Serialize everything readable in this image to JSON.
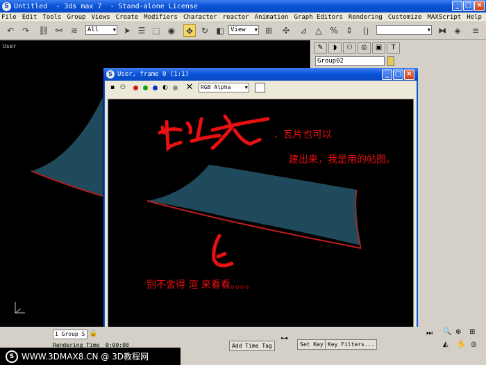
{
  "window": {
    "title": "Untitled  - 3ds max 7  - Stand-alone License",
    "controls": [
      "_",
      "□",
      "×"
    ]
  },
  "menu": [
    "File",
    "Edit",
    "Tools",
    "Group",
    "Views",
    "Create",
    "Modifiers",
    "Character",
    "reactor",
    "Animation",
    "Graph Editors",
    "Rendering",
    "Customize",
    "MAXScript",
    "Help"
  ],
  "toolbar": {
    "selection_filter": "All",
    "ref_coord": "View",
    "named_selection": ""
  },
  "viewport": {
    "label": "User"
  },
  "command_panel": {
    "object_name": "Group02"
  },
  "frame_window": {
    "title": "User, frame 0 (1:1)",
    "channel": "RGB Alpha",
    "controls": [
      "_",
      "□",
      "×"
    ]
  },
  "annotations": {
    "line1": "．瓦片也可以",
    "line2": "建出来，我是用的帖图。",
    "line3": "别不舍得  渲   来看看。。。。"
  },
  "status": {
    "selection": "1 Group S",
    "rendering_time_label": "Rendering Time",
    "rendering_time": "0:00:00",
    "x_value": "X",
    "add_time_tag": "Add Time Tag",
    "set_key": "Set Key",
    "key_filters": "Key Filters..."
  },
  "watermark": {
    "text": "WWW.3DMAX8.CN @ 3D教程网"
  },
  "colors": {
    "xp_blue": "#0a54d8",
    "annotation_red": "#e81010",
    "roof_tile": "#1f4a5c"
  }
}
